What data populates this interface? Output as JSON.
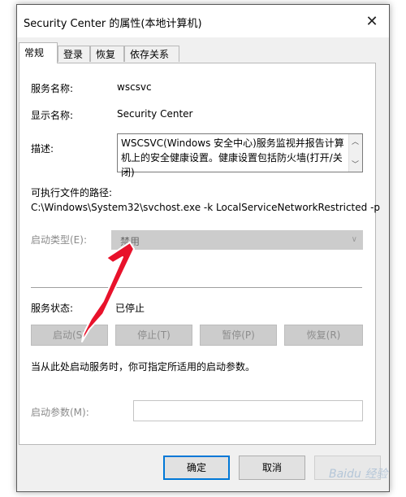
{
  "window": {
    "title": "Security Center 的属性(本地计算机)"
  },
  "tabs": [
    {
      "label": "常规",
      "active": true
    },
    {
      "label": "登录"
    },
    {
      "label": "恢复"
    },
    {
      "label": "依存关系"
    }
  ],
  "general": {
    "service_name_label": "服务名称:",
    "service_name": "wscsvc",
    "display_name_label": "显示名称:",
    "display_name": "Security Center",
    "description_label": "描述:",
    "description": "WSCSVC(Windows 安全中心)服务监视并报告计算机上的安全健康设置。健康设置包括防火墙(打开/关闭)",
    "path_label": "可执行文件的路径:",
    "path": "C:\\Windows\\System32\\svchost.exe -k LocalServiceNetworkRestricted -p",
    "startup_type_label": "启动类型(E):",
    "startup_type_value": "禁用",
    "status_label": "服务状态:",
    "status_value": "已停止",
    "buttons": {
      "start": "启动(S)",
      "stop": "停止(T)",
      "pause": "暂停(P)",
      "resume": "恢复(R)"
    },
    "hint": "当从此处启动服务时，你可指定所适用的启动参数。",
    "params_label": "启动参数(M):",
    "params_value": ""
  },
  "footer": {
    "ok": "确定",
    "cancel": "取消"
  },
  "watermark": "Baidu 经验",
  "colors": {
    "accent": "#0078d7",
    "annotation_arrow": "#e8122b"
  }
}
